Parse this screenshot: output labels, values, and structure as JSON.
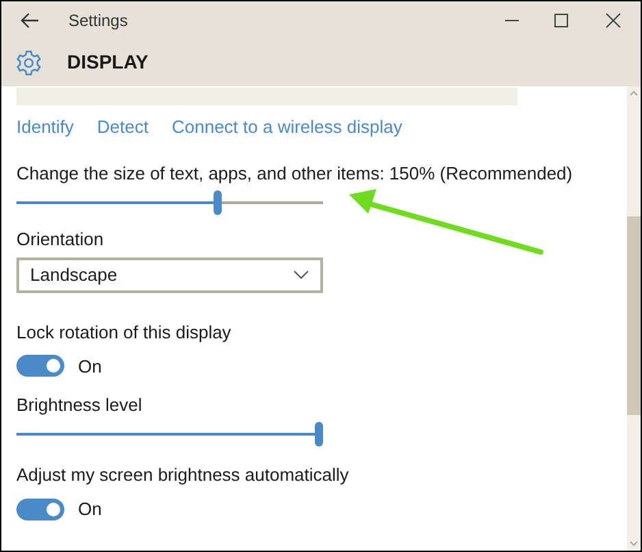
{
  "window": {
    "title": "Settings"
  },
  "header": {
    "title": "DISPLAY"
  },
  "links": [
    "Identify",
    "Detect",
    "Connect to a wireless display"
  ],
  "settings": [
    {
      "kind": "slider",
      "label": "Change the size of text, apps, and other items: 150% (Recommended)",
      "level": 0.66
    },
    {
      "kind": "dropdown",
      "label": "Orientation",
      "value": "Landscape"
    },
    {
      "kind": "toggle",
      "label": "Lock rotation of this display",
      "on": true,
      "state": "On"
    },
    {
      "kind": "slider",
      "label": "Brightness level",
      "level": 1
    },
    {
      "kind": "toggle",
      "label": "Adjust my screen brightness automatically",
      "on": true,
      "state": "On"
    }
  ]
}
